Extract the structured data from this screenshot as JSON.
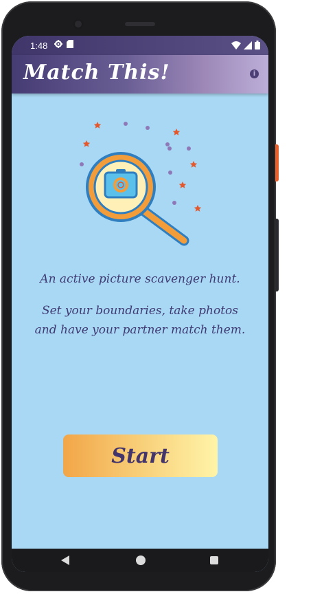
{
  "status_bar": {
    "time": "1:48",
    "left_icons": [
      "gear-icon",
      "sd-card-icon"
    ],
    "right_icons": [
      "wifi-icon",
      "signal-icon",
      "battery-icon"
    ]
  },
  "app_bar": {
    "title": "Match This!",
    "info_icon_glyph": "i"
  },
  "main": {
    "illustration": "magnifying-glass-camera-icon",
    "tagline": "An active picture scavenger hunt.",
    "description": "Set your boundaries, take photos and have your partner match them.",
    "start_label": "Start"
  },
  "nav_bar": {
    "buttons": [
      "back",
      "home",
      "recents"
    ]
  },
  "colors": {
    "screen_bg": "#a8d8f4",
    "text": "#3f3a72",
    "accent_orange": "#f29d3a",
    "lens_blue": "#2f7fc0",
    "star_red": "#e3582d",
    "dot_purple": "#8f78b7"
  }
}
